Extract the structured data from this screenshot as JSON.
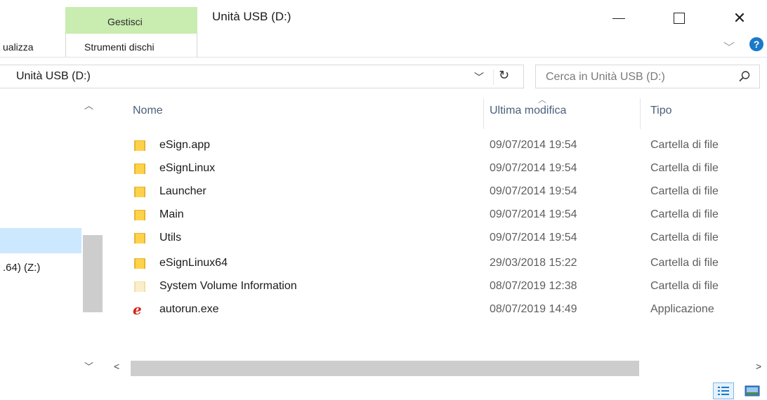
{
  "window": {
    "title": "Unità USB (D:)",
    "context_tab_group": "Gestisci",
    "context_tab": "Strumenti dischi",
    "ribbon_tab_left": "ualizza",
    "help_label": "?"
  },
  "address": {
    "path": "Unità USB (D:)"
  },
  "search": {
    "placeholder": "Cerca in Unità USB (D:)"
  },
  "nav": {
    "drive_z_label": ".64) (Z:)"
  },
  "columns": {
    "name": "Nome",
    "modified": "Ultima modifica",
    "type": "Tipo"
  },
  "files": [
    {
      "name": "eSign.app",
      "modified": "09/07/2014 19:54",
      "type": "Cartella di file",
      "icon": "folder-icon"
    },
    {
      "name": "eSignLinux",
      "modified": "09/07/2014 19:54",
      "type": "Cartella di file",
      "icon": "folder-icon"
    },
    {
      "name": "Launcher",
      "modified": "09/07/2014 19:54",
      "type": "Cartella di file",
      "icon": "folder-icon"
    },
    {
      "name": "Main",
      "modified": "09/07/2014 19:54",
      "type": "Cartella di file",
      "icon": "folder-icon"
    },
    {
      "name": "Utils",
      "modified": "09/07/2014 19:54",
      "type": "Cartella di file",
      "icon": "folder-icon"
    },
    {
      "name": "eSignLinux64",
      "modified": "29/03/2018 15:22",
      "type": "Cartella di file",
      "icon": "folder-icon"
    },
    {
      "name": "System Volume Information",
      "modified": "08/07/2019 12:38",
      "type": "Cartella di file",
      "icon": "hidden-folder-icon"
    },
    {
      "name": "autorun.exe",
      "modified": "08/07/2019 14:49",
      "type": "Applicazione",
      "icon": "application-icon"
    }
  ],
  "colors": {
    "context_tab": "#c9ecb0",
    "selection": "#cce8ff",
    "help": "#1979ca",
    "app_icon": "#d62419"
  }
}
